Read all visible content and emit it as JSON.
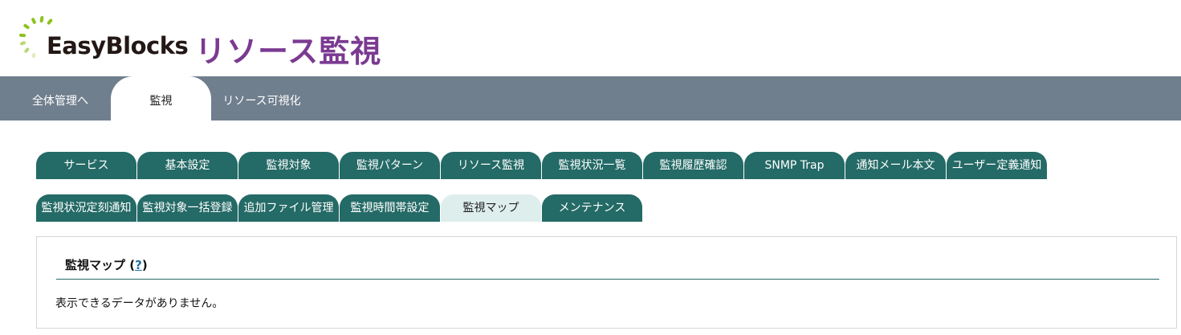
{
  "header": {
    "logo_text": "EasyBlocks",
    "app_title": "リソース監視"
  },
  "topnav": {
    "tabs": [
      {
        "label": "全体管理へ"
      },
      {
        "label": "監視"
      },
      {
        "label": "リソース可視化"
      }
    ],
    "active": "監視"
  },
  "subtabs": {
    "row1": [
      {
        "label": "サービス"
      },
      {
        "label": "基本設定"
      },
      {
        "label": "監視対象"
      },
      {
        "label": "監視パターン"
      },
      {
        "label": "リソース監視"
      },
      {
        "label": "監視状況一覧"
      },
      {
        "label": "監視履歴確認"
      },
      {
        "label": "SNMP Trap"
      },
      {
        "label": "通知メール本文"
      },
      {
        "label": "ユーザー定義通知"
      }
    ],
    "row2": [
      {
        "label": "監視状況定刻通知"
      },
      {
        "label": "監視対象一括登録"
      },
      {
        "label": "追加ファイル管理"
      },
      {
        "label": "監視時間帯設定"
      },
      {
        "label": "監視マップ"
      },
      {
        "label": "メンテナンス"
      }
    ],
    "active": "監視マップ"
  },
  "panel": {
    "title": "監視マップ",
    "help_open": "(",
    "help_label": "?",
    "help_close": ")",
    "message": "表示できるデータがありません。"
  },
  "colors": {
    "nav_bar": "#707f8e",
    "tab": "#246a66",
    "tab_active": "#deeeed",
    "title_purple": "#7b3a91",
    "logo_green": "#8dc21f"
  }
}
